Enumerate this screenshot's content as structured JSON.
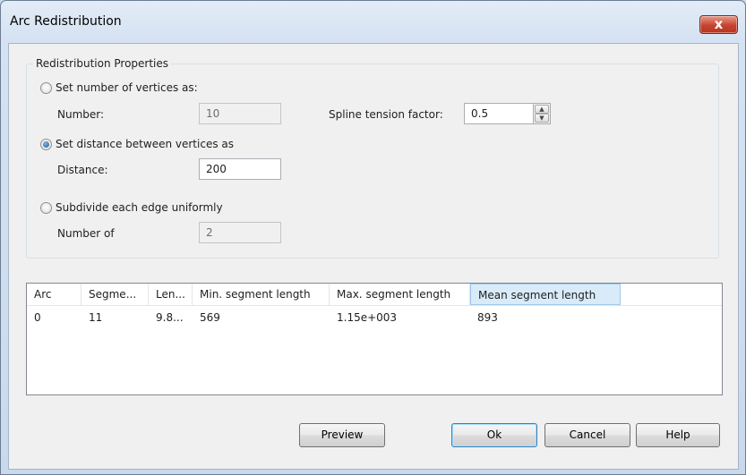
{
  "window": {
    "title": "Arc Redistribution",
    "close_label": "x"
  },
  "group": {
    "legend": "Redistribution Properties",
    "opt_vertices": {
      "label": "Set number of vertices as:",
      "checked": false
    },
    "number_label": "Number:",
    "number_value": "10",
    "spline_label": "Spline tension factor:",
    "spline_value": "0.5",
    "opt_distance": {
      "label": "Set distance between vertices as",
      "checked": true
    },
    "distance_label": "Distance:",
    "distance_value": "200",
    "opt_subdivide": {
      "label": "Subdivide each edge uniformly",
      "checked": false
    },
    "numberof_label": "Number of",
    "numberof_value": "2"
  },
  "table": {
    "columns": [
      "Arc",
      "Segme...",
      "Len...",
      "Min. segment length",
      "Max. segment length",
      "Mean segment length"
    ],
    "rows": [
      [
        "0",
        "11",
        "9.8...",
        "569",
        "1.15e+003",
        "893"
      ]
    ]
  },
  "buttons": {
    "preview": "Preview",
    "ok": "Ok",
    "cancel": "Cancel",
    "help": "Help"
  }
}
